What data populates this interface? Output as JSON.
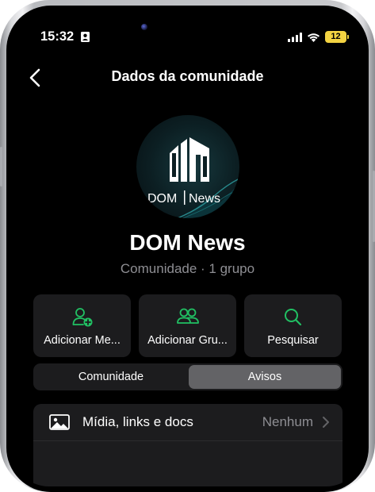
{
  "status_bar": {
    "time": "15:32",
    "battery": "12",
    "icons": [
      "contact-card-icon",
      "signal-icon",
      "wifi-icon",
      "battery-icon"
    ]
  },
  "nav": {
    "title": "Dados da comunidade",
    "back_icon": "chevron-left-icon"
  },
  "community": {
    "logo_text_left": "DOM",
    "logo_text_right": "News",
    "name": "DOM News",
    "subtitle": "Comunidade · 1 grupo"
  },
  "actions": [
    {
      "label": "Adicionar Me...",
      "icon": "add-member-icon"
    },
    {
      "label": "Adicionar Gru...",
      "icon": "add-group-icon"
    },
    {
      "label": "Pesquisar",
      "icon": "search-icon"
    }
  ],
  "segments": {
    "left": "Comunidade",
    "right": "Avisos",
    "selected": "Avisos"
  },
  "media_row": {
    "label": "Mídia, links e docs",
    "value": "Nenhum",
    "icon": "photo-icon"
  },
  "colors": {
    "accent_green": "#21c063",
    "background": "#000000",
    "card": "#1c1c1e",
    "secondary_text": "#8e8e93",
    "battery_low": "#f3d342"
  }
}
